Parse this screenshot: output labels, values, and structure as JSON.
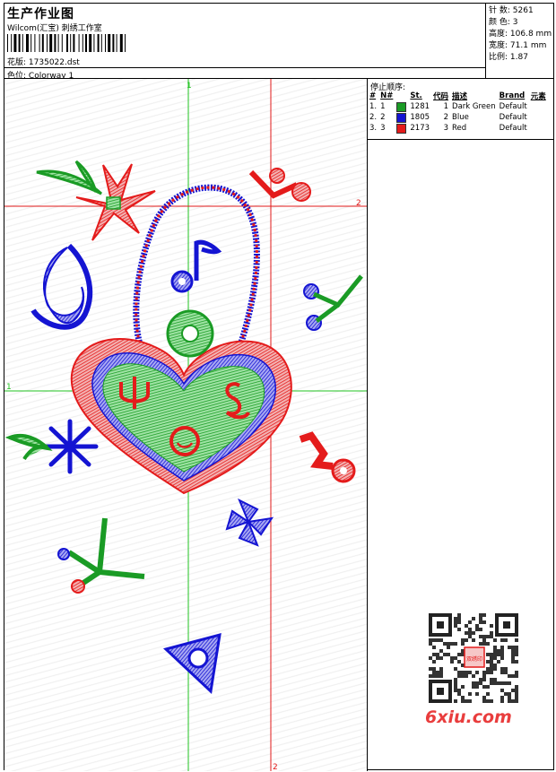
{
  "header": {
    "title": "生产作业图",
    "subtitle": "Wilcom(汇宝) 刺绣工作室",
    "design_label": "花版:",
    "design_value": "1735022.dst",
    "colorway_label": "色位:",
    "colorway_value": "Colorway 1"
  },
  "stats": {
    "stitches_label": "针 数:",
    "stitches_value": "5261",
    "colors_label": "颜 色:",
    "colors_value": "3",
    "height_label": "高度:",
    "height_value": "106.8 mm",
    "width_label": "宽度:",
    "width_value": "71.1 mm",
    "ratio_label": "比例:",
    "ratio_value": "1.87"
  },
  "stop_sequence": {
    "title": "停止顺序:",
    "columns": [
      "#",
      "N#",
      "St.",
      "代码",
      "描述",
      "Brand",
      "元素"
    ],
    "rows": [
      {
        "num": "1.",
        "n": "1",
        "color": "#1a9b25",
        "stitches": "1281",
        "code": "1",
        "desc": "Dark Green",
        "brand": "Default"
      },
      {
        "num": "2.",
        "n": "2",
        "color": "#1414d2",
        "stitches": "1805",
        "code": "2",
        "desc": "Blue",
        "brand": "Default"
      },
      {
        "num": "3.",
        "n": "3",
        "color": "#e41b1b",
        "stitches": "2173",
        "code": "3",
        "desc": "Red",
        "brand": "Default"
      }
    ]
  },
  "guides": {
    "v1_label": "1",
    "h1_label": "1",
    "h2_label": "2",
    "v2_label": "2"
  },
  "colors": {
    "green": "#1a9b25",
    "blue": "#1414d2",
    "red": "#e41b1b",
    "guide_green": "#22c322",
    "guide_red": "#e01818"
  },
  "watermark": {
    "text": "6xiu.com",
    "qr_stamp": "双绣印"
  }
}
